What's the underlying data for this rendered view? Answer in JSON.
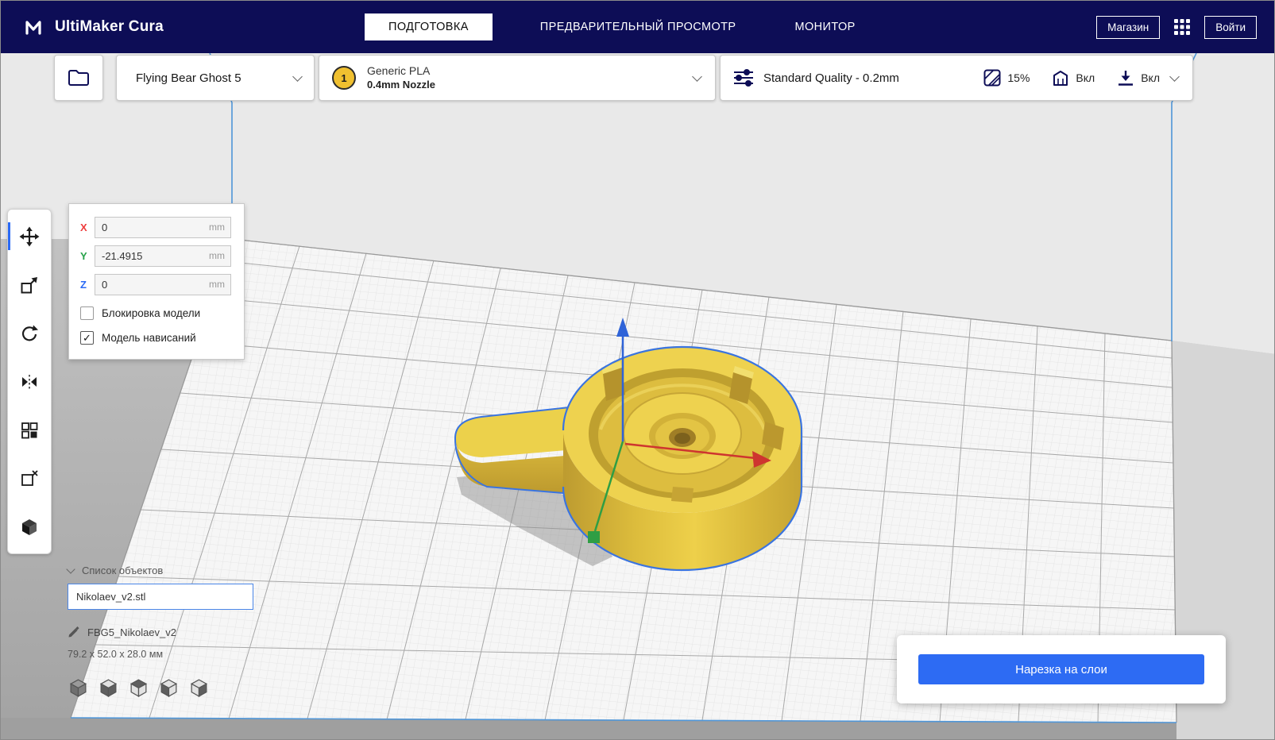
{
  "colors": {
    "accent_blue": "#2a6af5",
    "header_navy": "#0d0d56",
    "model_yellow": "#ecd14b",
    "selection_outline": "#3a74e0"
  },
  "header": {
    "app_title": "UltiMaker Cura",
    "tabs": [
      {
        "label": "ПОДГОТОВКА",
        "active": true
      },
      {
        "label": "ПРЕДВАРИТЕЛЬНЫЙ ПРОСМОТР",
        "active": false
      },
      {
        "label": "МОНИТОР",
        "active": false
      }
    ],
    "marketplace_label": "Магазин",
    "sign_in_label": "Войти"
  },
  "config_bar": {
    "printer_name": "Flying Bear Ghost 5",
    "extruder_number": "1",
    "material_name": "Generic PLA",
    "nozzle_size": "0.4mm Nozzle",
    "profile_label": "Standard Quality - 0.2mm",
    "infill_value": "15%",
    "support_value": "Вкл",
    "adhesion_value": "Вкл"
  },
  "move_panel": {
    "x_label": "X",
    "x_value": "0",
    "x_unit": "mm",
    "y_label": "Y",
    "y_value": "-21.4915",
    "y_unit": "mm",
    "z_label": "Z",
    "z_value": "0",
    "z_unit": "mm",
    "lock_model_label": "Блокировка модели",
    "drop_model_label": "Модель нависаний",
    "lock_model_checked": false,
    "drop_model_checked": true
  },
  "object_list": {
    "title": "Список объектов",
    "selected_file": "Nikolaev_v2.stl",
    "job_name": "FBG5_Nikolaev_v2",
    "model_dimensions": "79.2 x 52.0 x 28.0 мм"
  },
  "slice_panel": {
    "slice_button_label": "Нарезка на слои"
  },
  "icons": {
    "check": "✓"
  }
}
